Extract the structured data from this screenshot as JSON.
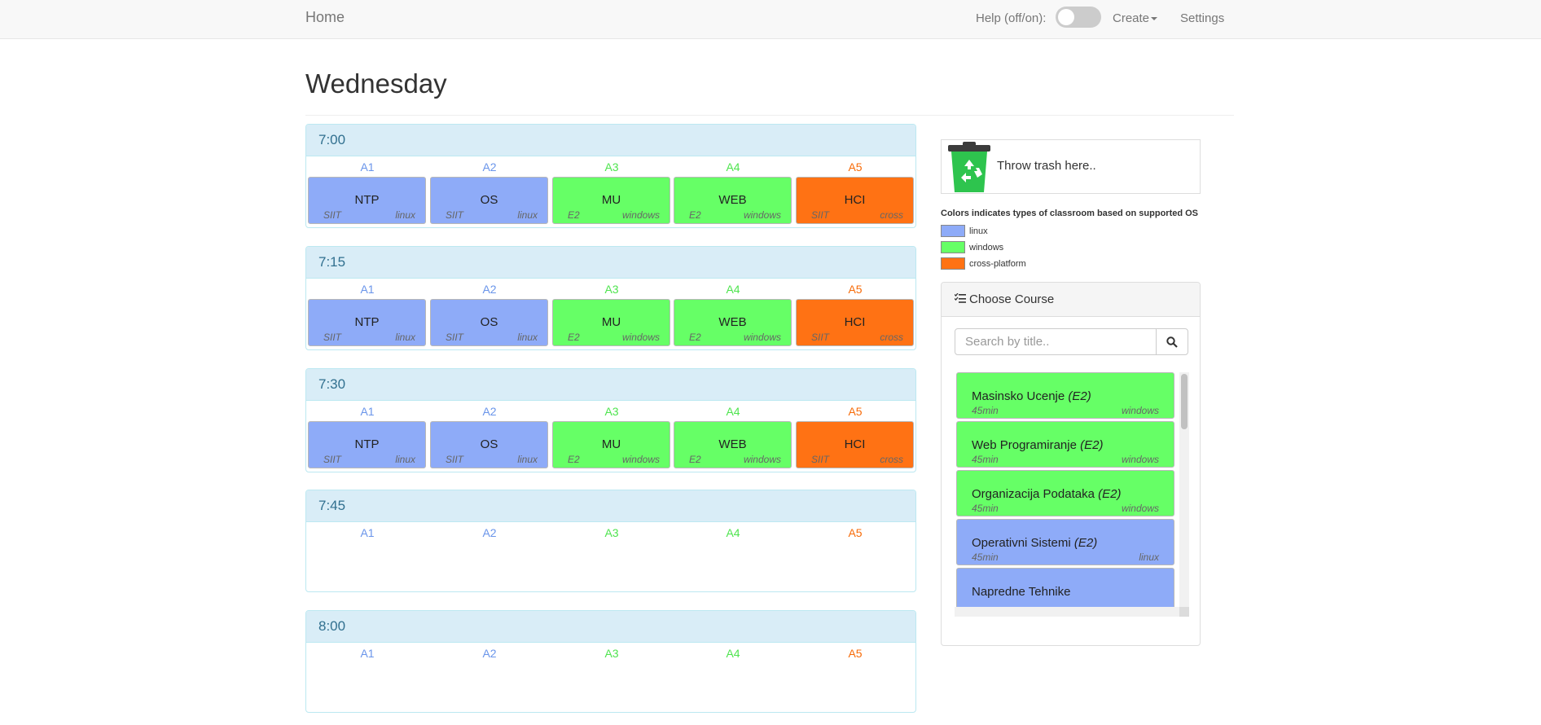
{
  "nav": {
    "brand": "Home",
    "help_label": "Help (off/on):",
    "create_label": "Create",
    "settings_label": "Settings"
  },
  "page_title": "Wednesday",
  "rooms": [
    {
      "name": "A1",
      "os": "linux"
    },
    {
      "name": "A2",
      "os": "linux"
    },
    {
      "name": "A3",
      "os": "windows"
    },
    {
      "name": "A4",
      "os": "windows"
    },
    {
      "name": "A5",
      "os": "cross"
    }
  ],
  "slots": [
    {
      "time": "7:00",
      "cells": [
        {
          "name": "NTP",
          "dept": "SIIT",
          "os": "linux"
        },
        {
          "name": "OS",
          "dept": "SIIT",
          "os": "linux"
        },
        {
          "name": "MU",
          "dept": "E2",
          "os": "windows"
        },
        {
          "name": "WEB",
          "dept": "E2",
          "os": "windows"
        },
        {
          "name": "HCI",
          "dept": "SIIT",
          "os": "cross"
        }
      ]
    },
    {
      "time": "7:15",
      "cells": [
        {
          "name": "NTP",
          "dept": "SIIT",
          "os": "linux"
        },
        {
          "name": "OS",
          "dept": "SIIT",
          "os": "linux"
        },
        {
          "name": "MU",
          "dept": "E2",
          "os": "windows"
        },
        {
          "name": "WEB",
          "dept": "E2",
          "os": "windows"
        },
        {
          "name": "HCI",
          "dept": "SIIT",
          "os": "cross"
        }
      ]
    },
    {
      "time": "7:30",
      "cells": [
        {
          "name": "NTP",
          "dept": "SIIT",
          "os": "linux"
        },
        {
          "name": "OS",
          "dept": "SIIT",
          "os": "linux"
        },
        {
          "name": "MU",
          "dept": "E2",
          "os": "windows"
        },
        {
          "name": "WEB",
          "dept": "E2",
          "os": "windows"
        },
        {
          "name": "HCI",
          "dept": "SIIT",
          "os": "cross"
        }
      ]
    },
    {
      "time": "7:45",
      "cells": []
    },
    {
      "time": "8:00",
      "cells": []
    }
  ],
  "trash": {
    "label": "Throw trash here.."
  },
  "legend": {
    "title": "Colors indicates types of classroom based on supported OS",
    "items": [
      {
        "label": "linux",
        "color": "#8eabf8"
      },
      {
        "label": "windows",
        "color": "#66ff66"
      },
      {
        "label": "cross-platform",
        "color": "#ff7214"
      }
    ]
  },
  "course_panel": {
    "title": "Choose Course",
    "search_placeholder": "Search by title..",
    "courses": [
      {
        "title": "Masinsko Ucenje",
        "dept": "(E2)",
        "duration": "45min",
        "os": "windows"
      },
      {
        "title": "Web Programiranje",
        "dept": "(E2)",
        "duration": "45min",
        "os": "windows"
      },
      {
        "title": "Organizacija Podataka",
        "dept": "(E2)",
        "duration": "45min",
        "os": "windows"
      },
      {
        "title": "Operativni Sistemi",
        "dept": "(E2)",
        "duration": "45min",
        "os": "linux"
      },
      {
        "title": "Napredne Tehnike",
        "dept": "",
        "duration": "",
        "os": "linux"
      }
    ]
  },
  "colors": {
    "linux": "#8eabf8",
    "windows": "#66ff66",
    "cross": "#ff7214",
    "slot_header_bg": "#d9edf7",
    "slot_header_text": "#31708f"
  }
}
